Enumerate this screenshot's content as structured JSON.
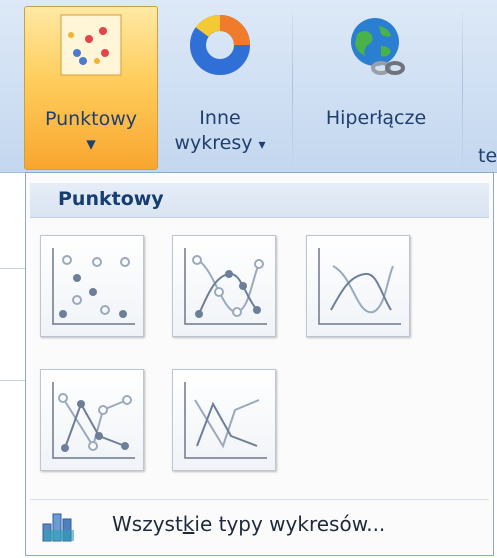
{
  "ribbon": {
    "scatter_button": {
      "label": "Punktowy",
      "arrow": "▾",
      "icon": "scatter-chart-icon"
    },
    "other_charts_button": {
      "label_line1": "Inne",
      "label_line2": "wykresy",
      "arrow": "▾",
      "icon": "doughnut-chart-icon"
    },
    "hyperlink_button": {
      "label": "Hiperłącze",
      "icon": "globe-link-icon"
    },
    "partial_button": {
      "label_fragment": "te"
    }
  },
  "gallery": {
    "header": "Punktowy",
    "items": [
      {
        "name": "scatter-markers-only",
        "icon": "scatter-markers-only-icon"
      },
      {
        "name": "scatter-smooth-lines-markers",
        "icon": "scatter-smooth-lines-markers-icon"
      },
      {
        "name": "scatter-smooth-lines",
        "icon": "scatter-smooth-lines-icon"
      },
      {
        "name": "scatter-straight-lines-markers",
        "icon": "scatter-straight-lines-markers-icon"
      },
      {
        "name": "scatter-straight-lines",
        "icon": "scatter-straight-lines-icon"
      }
    ],
    "footer": {
      "label_before": "Wszyst",
      "label_accel": "k",
      "label_after": "ie typy wykresów...",
      "icon": "all-chart-types-icon"
    }
  },
  "colors": {
    "ribbon_bg": "#cfdff3",
    "active_button": "#ffcd5c",
    "header_text": "#163e72",
    "marker_filled": "#6d7f98",
    "marker_hollow": "#9aa9bd"
  }
}
